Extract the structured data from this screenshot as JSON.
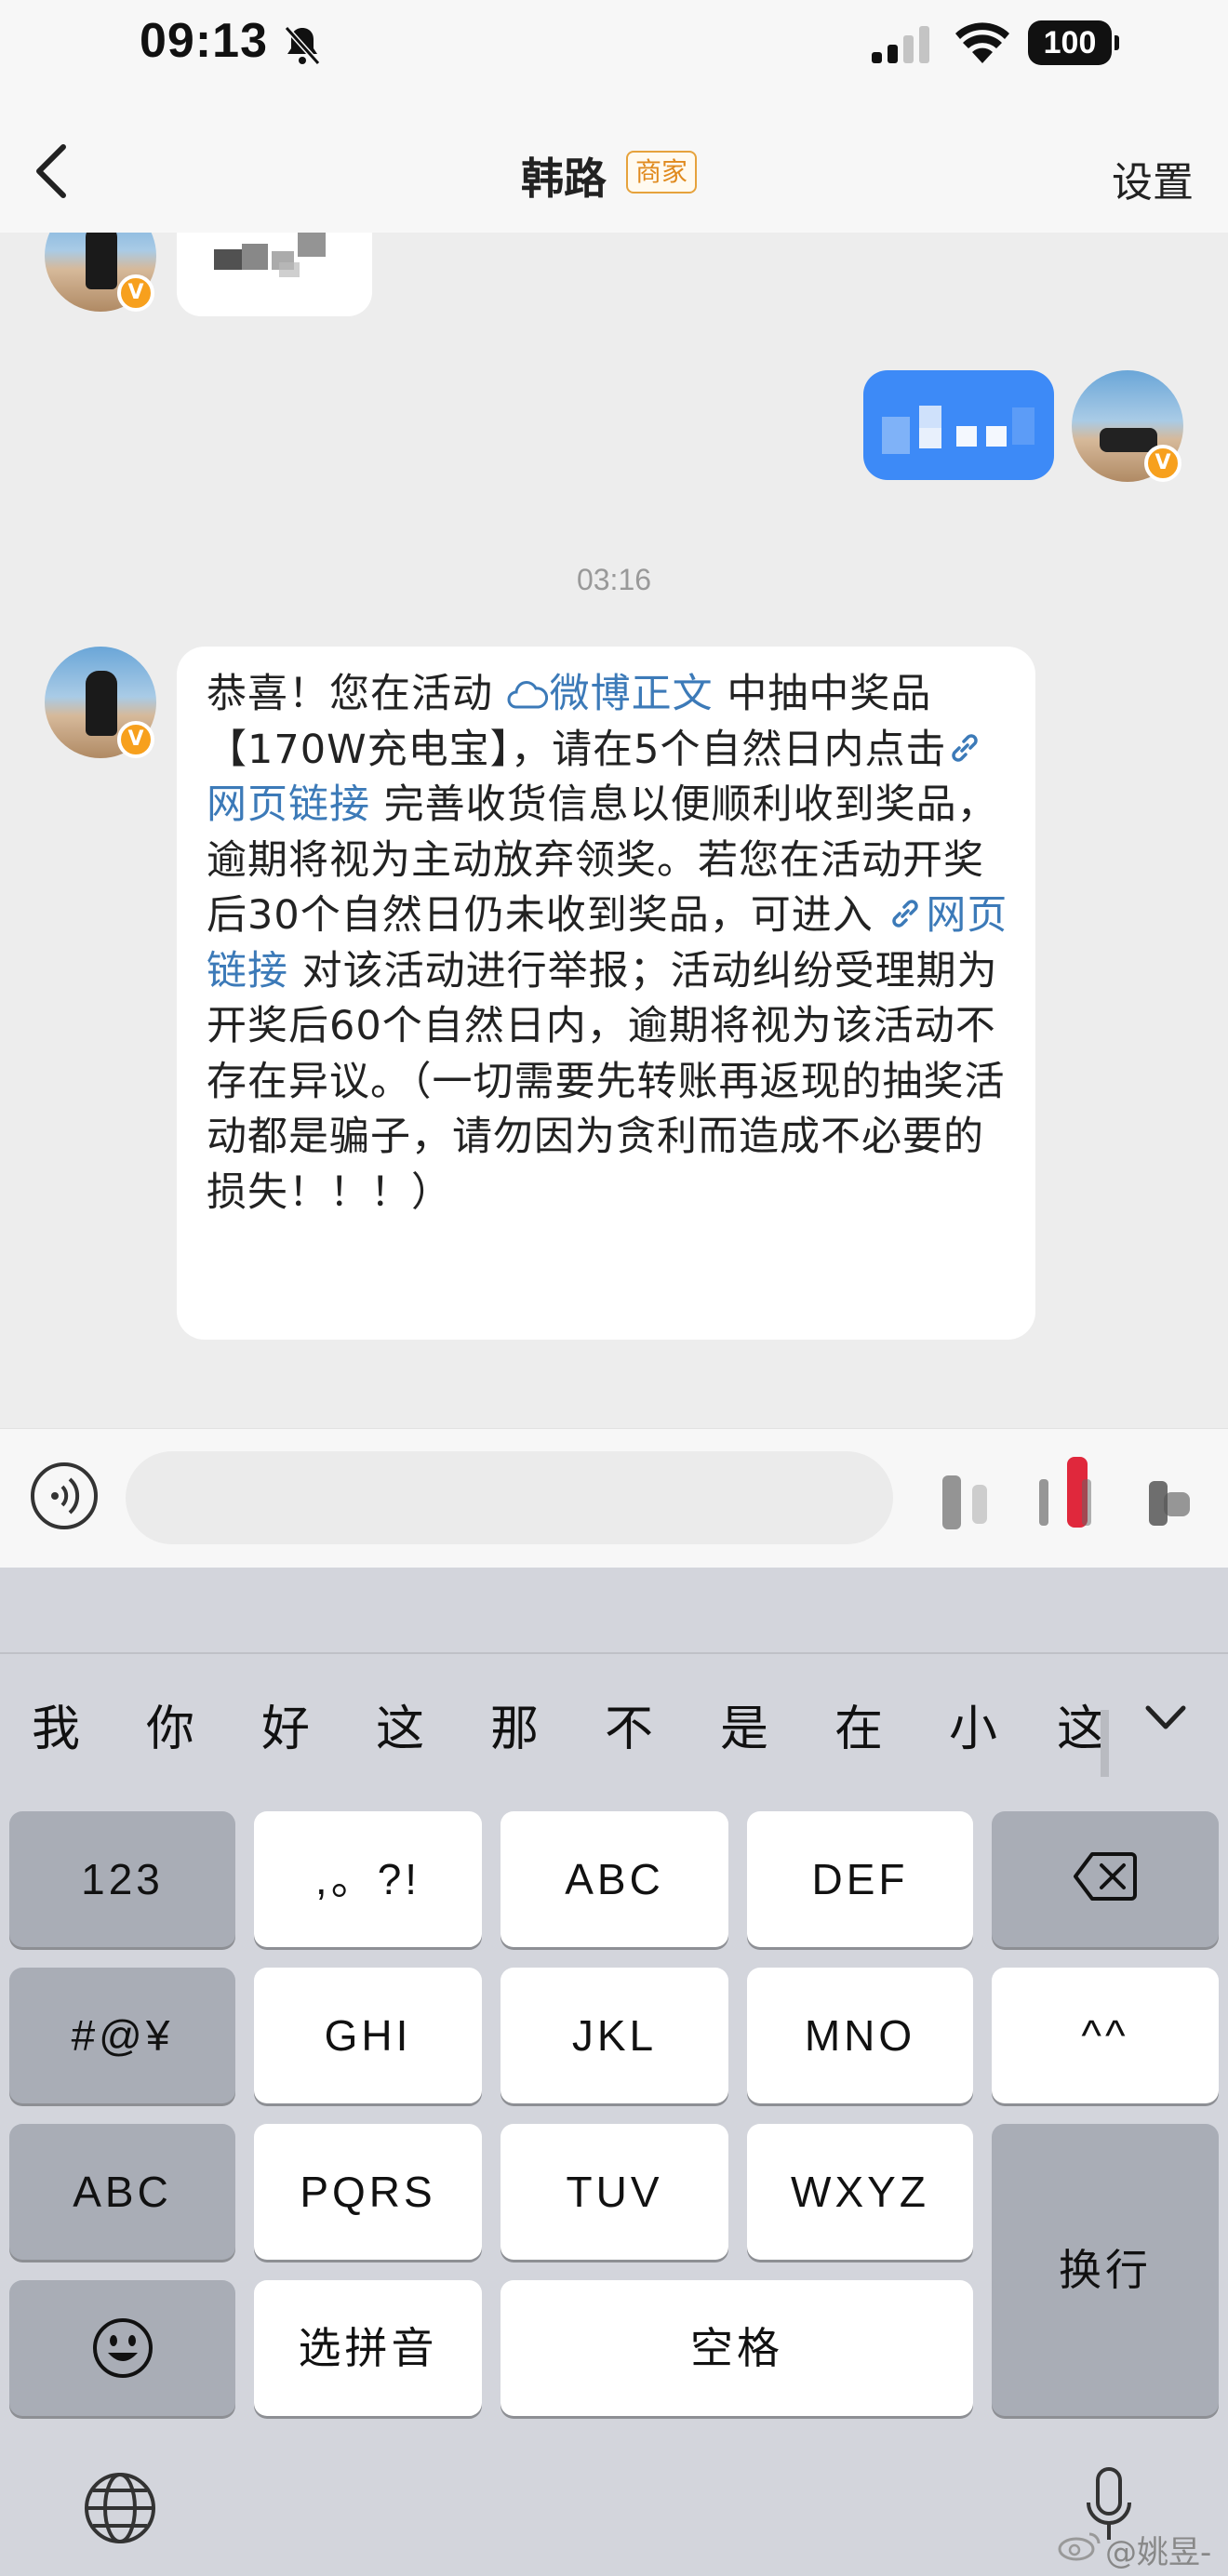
{
  "status": {
    "time": "09:13",
    "battery": "100"
  },
  "nav": {
    "title": "韩路",
    "badge": "商家",
    "settings": "设置"
  },
  "chat": {
    "timestamp": "03:16",
    "message": {
      "p1": "恭喜！您在活动 ",
      "link1": "微博正文",
      "p2": " 中抽中奖品【170W充电宝】，请在5个自然日内点击",
      "link2": "网页链接",
      "p3": " 完善收货信息以便顺利收到奖品，逾期将视为主动放弃领奖。若您在活动开奖后30个自然日仍未收到奖品，可进入 ",
      "link3": "网页链接",
      "p4": " 对该活动进行举报；活动纠纷受理期为开奖后60个自然日内，逾期将视为该活动不存在异议。（一切需要先转账再返现的抽奖活动都是骗子，请勿因为贪利而造成不必要的损失！！！）"
    }
  },
  "keyboard": {
    "candidates": [
      "我",
      "你",
      "好",
      "这",
      "那",
      "不",
      "是",
      "在",
      "小",
      "这"
    ],
    "keys": {
      "k123": "123",
      "punct": ",。?!",
      "abc": "ABC",
      "def": "DEF",
      "symbols": "#@¥",
      "ghi": "GHI",
      "jkl": "JKL",
      "mno": "MNO",
      "kaomoji": "^^",
      "abc_switch": "ABC",
      "pqrs": "PQRS",
      "tuv": "TUV",
      "wxyz": "WXYZ",
      "return": "换行",
      "pinyin": "选拼音",
      "space": "空格"
    }
  },
  "watermark": "@姚昱-",
  "colors": {
    "link": "#3c7ab8",
    "bubble_self": "#3d8af7",
    "badge": "#e08a1e",
    "verified": "#f7a01d"
  }
}
